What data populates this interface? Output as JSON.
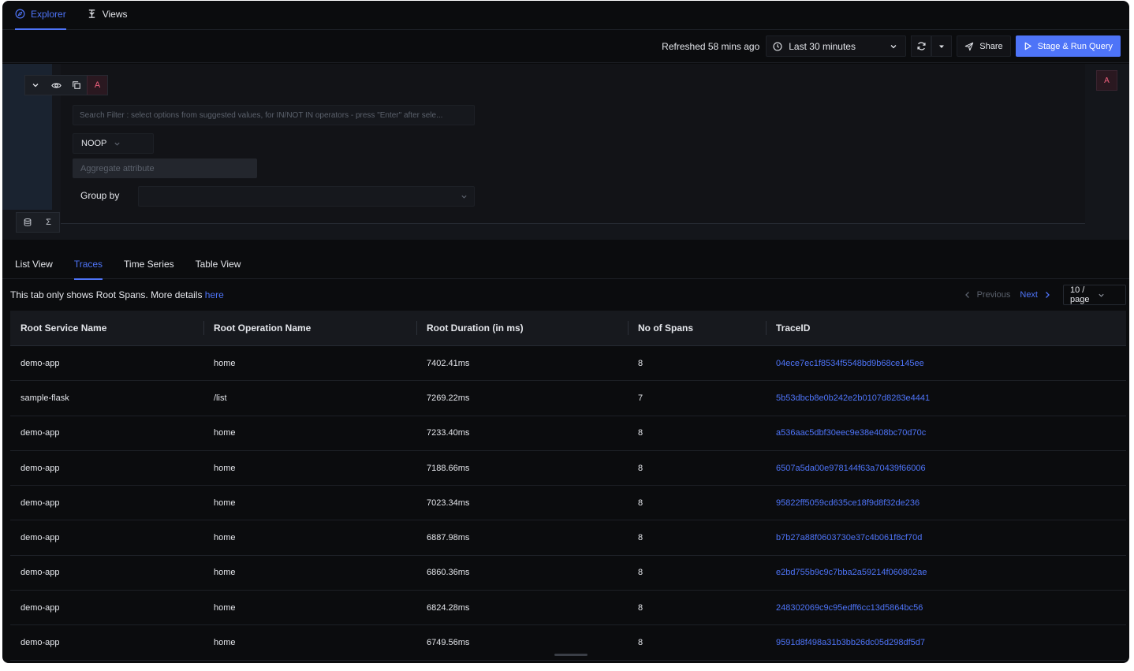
{
  "topnav": {
    "tabs": [
      {
        "label": "Explorer",
        "icon": "compass-icon",
        "active": true
      },
      {
        "label": "Views",
        "icon": "views-icon",
        "active": false
      }
    ]
  },
  "actionbar": {
    "refreshed": "Refreshed 58 mins ago",
    "time_range": "Last 30 minutes",
    "share_label": "Share",
    "run_label": "Stage & Run Query"
  },
  "query_builder": {
    "query_letter": "A",
    "search_placeholder": "Search Filter : select options from suggested values, for IN/NOT IN operators - press \"Enter\" after sele...",
    "aggregate_operator": "NOOP",
    "aggregate_attribute_placeholder": "Aggregate attribute",
    "group_by_label": "Group by",
    "right_letter": "A",
    "sigma": "Σ"
  },
  "view_tabs": [
    {
      "label": "List View",
      "active": false
    },
    {
      "label": "Traces",
      "active": true
    },
    {
      "label": "Time Series",
      "active": false
    },
    {
      "label": "Table View",
      "active": false
    }
  ],
  "info": {
    "message": "This tab only shows Root Spans. More details ",
    "link": "here"
  },
  "pager": {
    "previous": "Previous",
    "next": "Next",
    "page_size": "10 / page"
  },
  "table": {
    "columns": [
      "Root Service Name",
      "Root Operation Name",
      "Root Duration (in ms)",
      "No of Spans",
      "TraceID"
    ],
    "rows": [
      [
        "demo-app",
        "home",
        "7402.41ms",
        "8",
        "04ece7ec1f8534f5548bd9b68ce145ee"
      ],
      [
        "sample-flask",
        "/list",
        "7269.22ms",
        "7",
        "5b53dbcb8e0b242e2b0107d8283e4441"
      ],
      [
        "demo-app",
        "home",
        "7233.40ms",
        "8",
        "a536aac5dbf30eec9e38e408bc70d70c"
      ],
      [
        "demo-app",
        "home",
        "7188.66ms",
        "8",
        "6507a5da00e978144f63a70439f66006"
      ],
      [
        "demo-app",
        "home",
        "7023.34ms",
        "8",
        "95822ff5059cd635ce18f9d8f32de236"
      ],
      [
        "demo-app",
        "home",
        "6887.98ms",
        "8",
        "b7b27a88f0603730e37c4b061f8cf70d"
      ],
      [
        "demo-app",
        "home",
        "6860.36ms",
        "8",
        "e2bd755b9c9c7bba2a59214f060802ae"
      ],
      [
        "demo-app",
        "home",
        "6824.28ms",
        "8",
        "248302069c9c95edff6cc13d5864bc56"
      ],
      [
        "demo-app",
        "home",
        "6749.56ms",
        "8",
        "9591d8f498a31b3bb26dc05d298df5d7"
      ]
    ]
  },
  "colors": {
    "accent": "#4e74f8",
    "background": "#0b0c0e",
    "query_letter": "#f0607e"
  }
}
